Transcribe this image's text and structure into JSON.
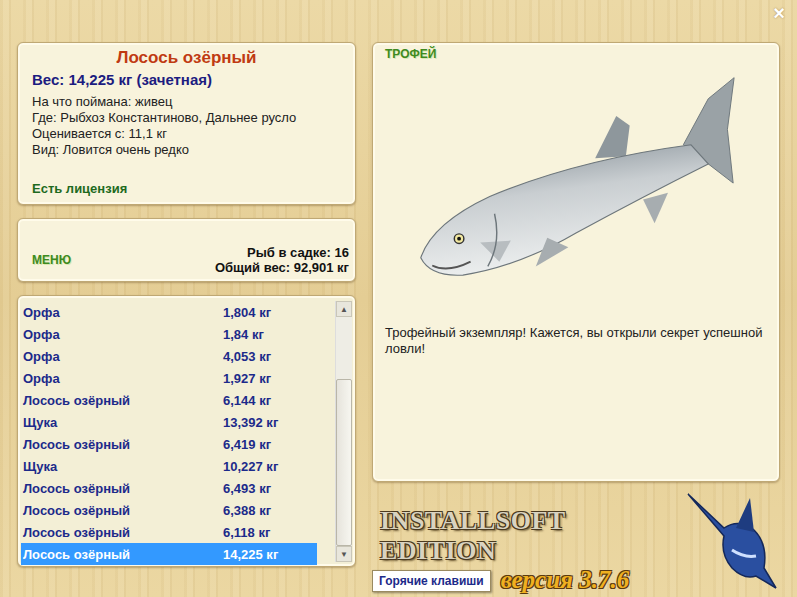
{
  "window": {
    "close_icon": "×"
  },
  "catch": {
    "title": "Лосось озёрный",
    "weight": "Вес: 14,225 кг (зачетная)",
    "details": [
      "На что поймана: живец",
      "Где: Рыбхоз Константиново, Дальнее русло",
      "Оценивается с: 11,1 кг",
      "Вид: Ловится очень редко"
    ],
    "license": "Есть лицензия"
  },
  "menu": {
    "label": "МЕНЮ",
    "fish_count": "Рыб в садке: 16",
    "total_weight": "Общий вес: 92,901 кг"
  },
  "catch_list": {
    "rows": [
      {
        "name": "Орфа",
        "weight": "1,804 кг",
        "selected": false
      },
      {
        "name": "Орфа",
        "weight": "1,84 кг",
        "selected": false
      },
      {
        "name": "Орфа",
        "weight": "4,053 кг",
        "selected": false
      },
      {
        "name": "Орфа",
        "weight": "1,927 кг",
        "selected": false
      },
      {
        "name": "Лосось озёрный",
        "weight": "6,144 кг",
        "selected": false
      },
      {
        "name": "Щука",
        "weight": "13,392 кг",
        "selected": false
      },
      {
        "name": "Лосось озёрный",
        "weight": "6,419 кг",
        "selected": false
      },
      {
        "name": "Щука",
        "weight": "10,227 кг",
        "selected": false
      },
      {
        "name": "Лосось озёрный",
        "weight": "6,493 кг",
        "selected": false
      },
      {
        "name": "Лосось озёрный",
        "weight": "6,388 кг",
        "selected": false
      },
      {
        "name": "Лосось озёрный",
        "weight": "6,118 кг",
        "selected": false
      },
      {
        "name": "Лосось озёрный",
        "weight": "14,225 кг",
        "selected": true
      }
    ],
    "scrollbar": {
      "up_icon": "▲",
      "down_icon": "▼",
      "scrolled_to_end": true
    }
  },
  "trophy": {
    "label": "ТРОФЕЙ",
    "message": "Трофейный экземпляр! Кажется, вы открыли секрет успешной ловли!"
  },
  "logo": {
    "title": "INSTALLSOFT EDITION",
    "version": "версия 3.7.6"
  },
  "hotkeys_button": "Горячие клавиши"
}
